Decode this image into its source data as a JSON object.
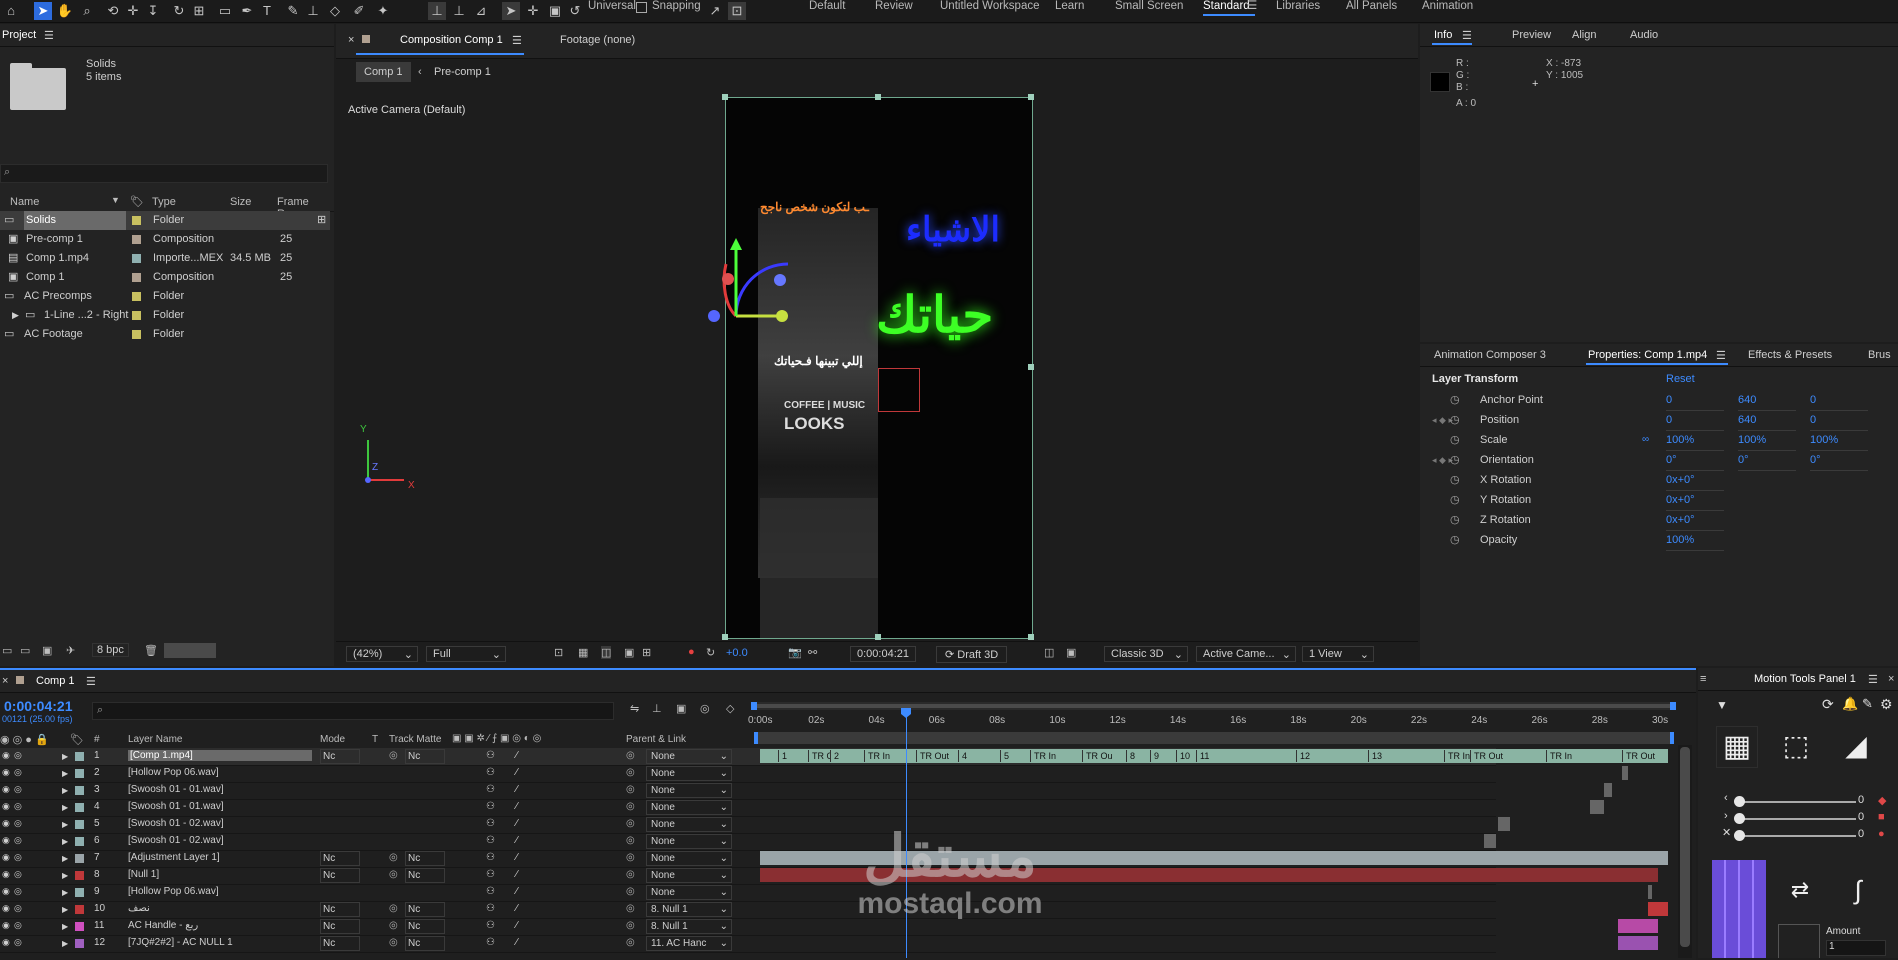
{
  "workspaces": [
    "Default",
    "Review",
    "Untitled Workspace",
    "Learn",
    "Small Screen",
    "Standard",
    "Libraries",
    "All Panels",
    "Animation"
  ],
  "toolbar": {
    "axis_mode": "Universal",
    "snapping_label": "Snapping"
  },
  "project": {
    "title": "Project",
    "folder_name": "Solids",
    "folder_count": "5 items",
    "search_placeholder": "",
    "columns": [
      "Name",
      "Type",
      "Size",
      "Frame Ra..."
    ],
    "items": [
      {
        "name": "Solids",
        "type": "Folder",
        "size": "",
        "fps": "",
        "color": "#c8c060"
      },
      {
        "name": "Pre-comp 1",
        "type": "Composition",
        "size": "",
        "fps": "25",
        "color": "#b0a090"
      },
      {
        "name": "Comp 1.mp4",
        "type": "Importe...MEX",
        "size": "34.5 MB",
        "fps": "25",
        "color": "#8fb0b0"
      },
      {
        "name": "Comp 1",
        "type": "Composition",
        "size": "",
        "fps": "25",
        "color": "#b0a090"
      },
      {
        "name": "AC Precomps",
        "type": "Folder",
        "size": "",
        "fps": "",
        "color": "#c8c060"
      },
      {
        "name": "1-Line ...2 - Right",
        "type": "Folder",
        "size": "",
        "fps": "",
        "color": "#c8c060"
      },
      {
        "name": "AC Footage",
        "type": "Folder",
        "size": "",
        "fps": "",
        "color": "#c8c060"
      }
    ],
    "bpc": "8 bpc"
  },
  "composition": {
    "tab_label": "Composition Comp 1",
    "footage_tab": "Footage (none)",
    "breadcrumbs": [
      "Comp 1",
      "Pre-comp 1"
    ],
    "camera_label": "Active Camera (Default)",
    "video_text": {
      "line_small": "ـب لتكون شخص ناجح",
      "word1": "الاشياء",
      "word2": "حياتك",
      "line_white": "إللي تبينها فـحياتك",
      "shirt1": "COFFEE | MUSIC",
      "shirt2": "LOOKS"
    },
    "axis_labels": {
      "y": "Y",
      "z": "Z",
      "x": "X"
    }
  },
  "viewer_controls": {
    "zoom": "(42%)",
    "resolution": "Full",
    "exposure": "+0.0",
    "timecode": "0:00:04:21",
    "draft": "Draft 3D",
    "renderer": "Classic 3D",
    "camera": "Active Came...",
    "views": "1 View"
  },
  "info": {
    "tabs": [
      "Info",
      "Preview",
      "Align",
      "Audio"
    ],
    "r": "R :",
    "g": "G :",
    "b": "B :",
    "a": "A :  0",
    "x": "X : -873",
    "y": "Y : 1005"
  },
  "properties": {
    "tabs": [
      "Animation Composer 3",
      "Properties: Comp 1.mp4",
      "Effects & Presets",
      "Brus"
    ],
    "section": "Layer Transform",
    "reset": "Reset",
    "rows": [
      {
        "name": "Anchor Point",
        "v1": "0",
        "v2": "640",
        "v3": "0"
      },
      {
        "name": "Position",
        "v1": "0",
        "v2": "640",
        "v3": "0"
      },
      {
        "name": "Scale",
        "v1": "100%",
        "v2": "100%",
        "v3": "100%"
      },
      {
        "name": "Orientation",
        "v1": "0°",
        "v2": "0°",
        "v3": "0°"
      },
      {
        "name": "X Rotation",
        "v1": "0x+0°",
        "v2": "",
        "v3": ""
      },
      {
        "name": "Y Rotation",
        "v1": "0x+0°",
        "v2": "",
        "v3": ""
      },
      {
        "name": "Z Rotation",
        "v1": "0x+0°",
        "v2": "",
        "v3": ""
      },
      {
        "name": "Opacity",
        "v1": "100%",
        "v2": "",
        "v3": ""
      }
    ]
  },
  "timeline": {
    "tab": "Comp 1",
    "timecode": "0:00:04:21",
    "frame_info": "00121 (25.00 fps)",
    "columns": [
      "#",
      "Layer Name",
      "Mode",
      "T",
      "Track Matte",
      "Parent & Link"
    ],
    "ruler": [
      "0:00s",
      "02s",
      "04s",
      "06s",
      "08s",
      "10s",
      "12s",
      "14s",
      "16s",
      "18s",
      "20s",
      "22s",
      "24s",
      "26s",
      "28s",
      "30s"
    ],
    "layers": [
      {
        "num": "1",
        "name": "[Comp 1.mp4]",
        "mode": "Nc",
        "matte": "Nc",
        "parent": "None",
        "color": "#8fb0b0"
      },
      {
        "num": "2",
        "name": "[Hollow Pop 06.wav]",
        "mode": "",
        "matte": "",
        "parent": "None",
        "color": "#8fb0b0"
      },
      {
        "num": "3",
        "name": "[Swoosh 01 - 01.wav]",
        "mode": "",
        "matte": "",
        "parent": "None",
        "color": "#8fb0b0"
      },
      {
        "num": "4",
        "name": "[Swoosh 01 - 01.wav]",
        "mode": "",
        "matte": "",
        "parent": "None",
        "color": "#8fb0b0"
      },
      {
        "num": "5",
        "name": "[Swoosh 01 - 02.wav]",
        "mode": "",
        "matte": "",
        "parent": "None",
        "color": "#8fb0b0"
      },
      {
        "num": "6",
        "name": "[Swoosh 01 - 02.wav]",
        "mode": "",
        "matte": "",
        "parent": "None",
        "color": "#8fb0b0"
      },
      {
        "num": "7",
        "name": "[Adjustment Layer 1]",
        "mode": "Nc",
        "matte": "Nc",
        "parent": "None",
        "color": "#9aa4a8"
      },
      {
        "num": "8",
        "name": "[Null 1]",
        "mode": "Nc",
        "matte": "Nc",
        "parent": "None",
        "color": "#c0383a"
      },
      {
        "num": "9",
        "name": "[Hollow Pop 06.wav]",
        "mode": "",
        "matte": "",
        "parent": "None",
        "color": "#8fb0b0"
      },
      {
        "num": "10",
        "name": "نصف",
        "mode": "Nc",
        "matte": "Nc",
        "parent": "8. Null 1",
        "color": "#c0383a"
      },
      {
        "num": "11",
        "name": "AC Handle - ربع",
        "mode": "Nc",
        "matte": "Nc",
        "parent": "8. Null 1",
        "color": "#d050c0"
      },
      {
        "num": "12",
        "name": "[7JQ#2#2] - AC NULL 1",
        "mode": "Nc",
        "matte": "Nc",
        "parent": "11. AC Hanc",
        "color": "#a060c0"
      }
    ],
    "markers": [
      "1",
      "TR Out",
      "2",
      "TR In",
      "TR Out",
      "4",
      "5",
      "TR In",
      "TR Ou",
      "8",
      "9",
      "10",
      "11",
      "12",
      "13",
      "TR In",
      "TR Out",
      "TR In",
      "TR Out"
    ]
  },
  "motion_tools": {
    "title": "Motion Tools Panel 1",
    "values": [
      "0",
      "0",
      "0"
    ],
    "amount_label": "Amount",
    "amount_value": "1"
  },
  "watermark": {
    "arabic": "مستقل",
    "latin": "mostaql.com"
  }
}
